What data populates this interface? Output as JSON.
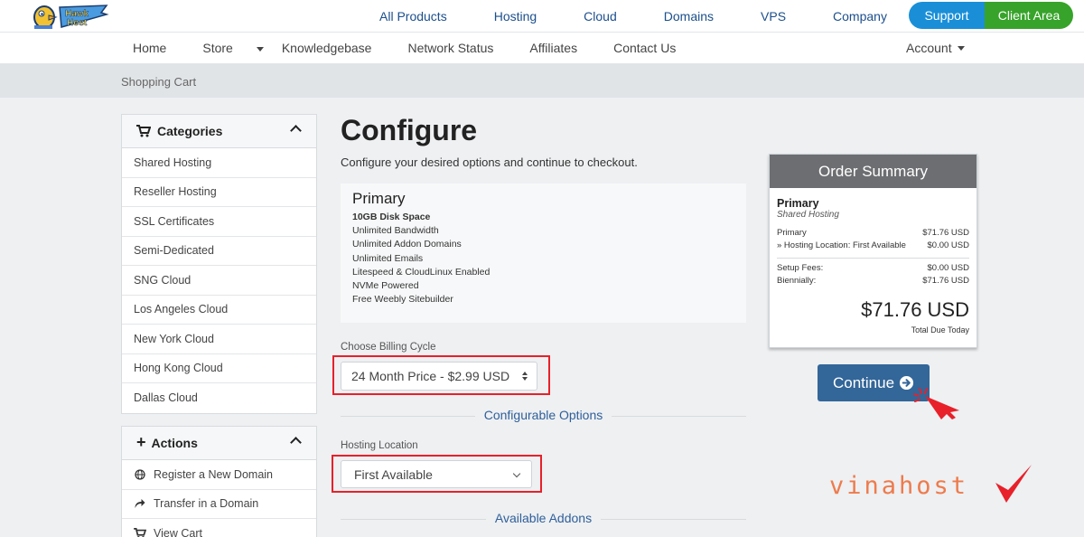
{
  "header": {
    "logo_text": "Hawk Host",
    "nav": [
      "All Products",
      "Hosting",
      "Cloud",
      "Domains",
      "VPS",
      "Company"
    ],
    "support_label": "Support",
    "client_area_label": "Client Area"
  },
  "subnav": {
    "items": [
      {
        "label": "Home",
        "dropdown": false
      },
      {
        "label": "Store",
        "dropdown": true
      },
      {
        "label": "Knowledgebase",
        "dropdown": false
      },
      {
        "label": "Network Status",
        "dropdown": false
      },
      {
        "label": "Affiliates",
        "dropdown": false
      },
      {
        "label": "Contact Us",
        "dropdown": false
      }
    ],
    "account_label": "Account"
  },
  "breadcrumb": "Shopping Cart",
  "sidebar": {
    "categories_title": "Categories",
    "categories": [
      "Shared Hosting",
      "Reseller Hosting",
      "SSL Certificates",
      "Semi-Dedicated",
      "SNG Cloud",
      "Los Angeles Cloud",
      "New York Cloud",
      "Hong Kong Cloud",
      "Dallas Cloud"
    ],
    "actions_title": "Actions",
    "actions": [
      {
        "label": "Register a New Domain",
        "icon": "globe-icon"
      },
      {
        "label": "Transfer in a Domain",
        "icon": "share-icon"
      },
      {
        "label": "View Cart",
        "icon": "cart-icon"
      }
    ]
  },
  "main": {
    "title": "Configure",
    "subtitle": "Configure your desired options and continue to checkout.",
    "product": {
      "name": "Primary",
      "features": [
        "10GB Disk Space",
        "Unlimited Bandwidth",
        "Unlimited Addon Domains",
        "Unlimited Emails",
        "Litespeed & CloudLinux Enabled",
        "NVMe Powered",
        "Free Weebly Sitebuilder"
      ]
    },
    "billing_label": "Choose Billing Cycle",
    "billing_value": "24 Month Price - $2.99 USD",
    "configurable_options_heading": "Configurable Options",
    "location_label": "Hosting Location",
    "location_value": "First Available",
    "addons_heading": "Available Addons"
  },
  "summary": {
    "title": "Order Summary",
    "product_name": "Primary",
    "product_group": "Shared Hosting",
    "lines": [
      {
        "label": "Primary",
        "value": "$71.76 USD"
      },
      {
        "label": "» Hosting Location: First Available",
        "value": "$0.00 USD"
      }
    ],
    "fees": [
      {
        "label": "Setup Fees:",
        "value": "$0.00 USD"
      },
      {
        "label": "Biennially:",
        "value": "$71.76 USD"
      }
    ],
    "total": "$71.76 USD",
    "total_label": "Total Due Today"
  },
  "continue_label": "Continue",
  "watermark": "vinahost",
  "colors": {
    "brand_blue": "#1c4f8c",
    "support": "#1a8fd8",
    "client_area": "#37a32a",
    "continue": "#336699",
    "highlight": "#e8202a",
    "watermark": "#ee7b4c"
  }
}
